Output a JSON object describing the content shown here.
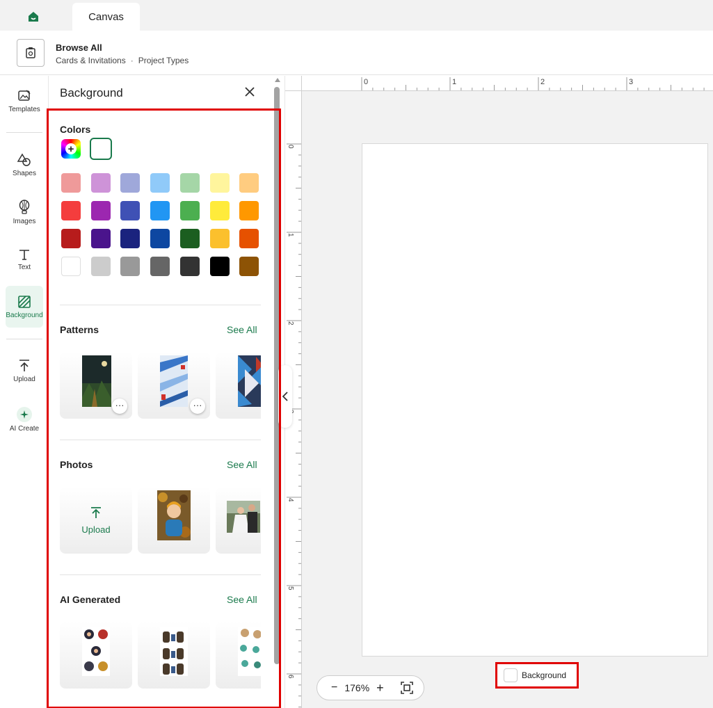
{
  "tabbar": {
    "tab_label": "Canvas",
    "home_icon": "home-icon"
  },
  "header": {
    "title": "Browse All",
    "breadcrumb": [
      "Cards & Invitations",
      "Project Types"
    ],
    "breadcrumb_sep": "·"
  },
  "rail": {
    "items": [
      {
        "label": "Templates",
        "icon": "templates-icon"
      },
      {
        "label": "Shapes",
        "icon": "shapes-icon"
      },
      {
        "label": "Images",
        "icon": "images-icon"
      },
      {
        "label": "Text",
        "icon": "text-icon"
      },
      {
        "label": "Background",
        "icon": "background-icon",
        "active": true
      },
      {
        "label": "Upload",
        "icon": "upload-icon"
      },
      {
        "label": "AI Create",
        "icon": "sparkle-icon"
      }
    ]
  },
  "panel": {
    "title": "Background",
    "colors": {
      "title": "Colors",
      "selected": "#ffffff",
      "swatches": [
        [
          "#ef9a9a",
          "#ce93d8",
          "#9fa8da",
          "#90caf9",
          "#a5d6a7",
          "#fff59d",
          "#ffcc80"
        ],
        [
          "#f43d3d",
          "#9c27b0",
          "#3f51b5",
          "#2196f3",
          "#4caf50",
          "#ffeb3b",
          "#ff9800"
        ],
        [
          "#b71c1c",
          "#4a148c",
          "#1a237e",
          "#0d47a1",
          "#1b5e20",
          "#fbc02d",
          "#e65100"
        ],
        [
          "#ffffff",
          "#cccccc",
          "#999999",
          "#666666",
          "#333333",
          "#000000",
          "#8d5305"
        ]
      ]
    },
    "patterns": {
      "title": "Patterns",
      "see_all": "See All"
    },
    "photos": {
      "title": "Photos",
      "see_all": "See All",
      "upload_label": "Upload"
    },
    "ai_generated": {
      "title": "AI Generated",
      "see_all": "See All"
    },
    "more_label": "···"
  },
  "canvas": {
    "ruler_top_labels": [
      "0",
      "1",
      "2",
      "3"
    ],
    "ruler_left_labels": [
      "0",
      "1",
      "2",
      "3",
      "4",
      "5",
      "6"
    ],
    "zoom": "176%",
    "zoom_minus": "−",
    "zoom_plus": "+",
    "background_label": "Background"
  },
  "colors": {
    "accent": "#1a7a4c",
    "highlight": "#e00000"
  }
}
